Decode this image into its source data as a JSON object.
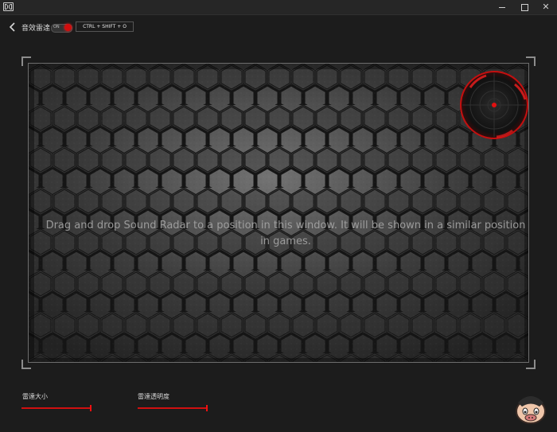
{
  "window": {
    "minimize_icon": "minimize-icon",
    "maximize_icon": "maximize-icon",
    "close_icon": "close-icon",
    "close_label": "✕"
  },
  "header": {
    "back_icon": "chevron-left-icon",
    "title": "音效雷達",
    "toggle_label": "ON",
    "shortcut": "CTRL + SHIFT + O"
  },
  "preview": {
    "instruction": "Drag and drop Sound Radar to a position in this window. It will be shown in a similar position in games.",
    "radar_icon": "sound-radar-icon"
  },
  "settings": {
    "size_label": "雷達大小",
    "size_value": 1.0,
    "opacity_label": "雷達透明度",
    "opacity_value": 1.0
  },
  "colors": {
    "accent": "#d01010",
    "background": "#1c1c1c",
    "panel": "#3b3b3b"
  }
}
